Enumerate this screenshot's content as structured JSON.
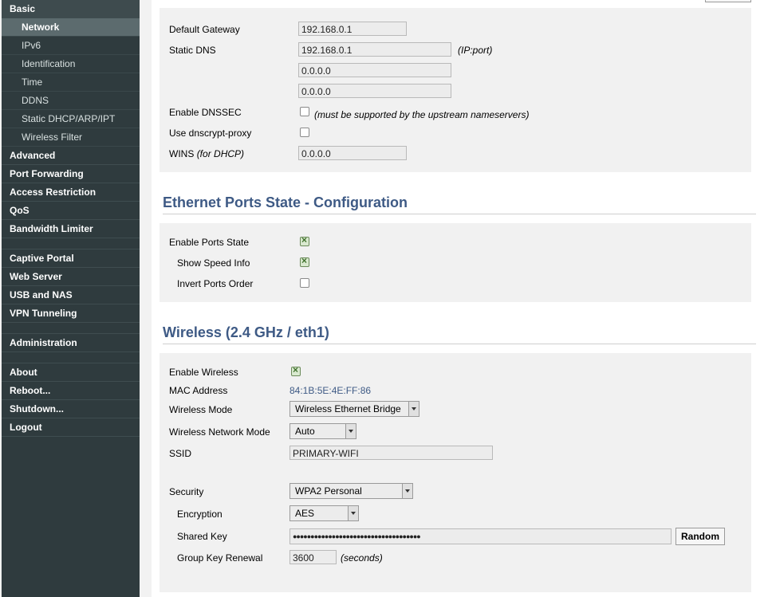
{
  "sidebar": {
    "basic": "Basic",
    "basic_items": [
      "Network",
      "IPv6",
      "Identification",
      "Time",
      "DDNS",
      "Static DHCP/ARP/IPT",
      "Wireless Filter"
    ],
    "group1": [
      "Advanced",
      "Port Forwarding",
      "Access Restriction",
      "QoS",
      "Bandwidth Limiter"
    ],
    "group2": [
      "Captive Portal",
      "Web Server",
      "USB and NAS",
      "VPN Tunneling"
    ],
    "group3": [
      "Administration"
    ],
    "group4": [
      "About",
      "Reboot...",
      "Shutdown...",
      "Logout"
    ]
  },
  "lan": {
    "default_gateway_label": "Default Gateway",
    "default_gateway": "192.168.0.1",
    "static_dns_label": "Static DNS",
    "dns1": "192.168.0.1",
    "dns2": "0.0.0.0",
    "dns3": "0.0.0.0",
    "dns_hint": "(IP:port)",
    "dnssec_label": "Enable DNSSEC",
    "dnssec_hint": "(must be supported by the upstream nameservers)",
    "dnscrypt_label": "Use dnscrypt-proxy",
    "wins_label": "WINS",
    "wins_suffix": "(for DHCP)",
    "wins": "0.0.0.0"
  },
  "ports": {
    "title": "Ethernet Ports State - Configuration",
    "enable_label": "Enable Ports State",
    "speed_label": "Show Speed Info",
    "invert_label": "Invert Ports Order",
    "enable_checked": true,
    "speed_checked": true,
    "invert_checked": false
  },
  "wireless": {
    "title": "Wireless (2.4 GHz / eth1)",
    "enable_label": "Enable Wireless",
    "enable_checked": true,
    "mac_label": "MAC Address",
    "mac": "84:1B:5E:4E:FF:86",
    "mode_label": "Wireless Mode",
    "mode": "Wireless Ethernet Bridge",
    "netmode_label": "Wireless Network Mode",
    "netmode": "Auto",
    "ssid_label": "SSID",
    "ssid": "PRIMARY-WIFI",
    "security_label": "Security",
    "security": "WPA2 Personal",
    "encryption_label": "Encryption",
    "encryption": "AES",
    "shared_key_label": "Shared Key",
    "shared_key": "●●●●●●●●●●●●●●●●●●●●●●●●●●●●●●●●●●●●",
    "random_label": "Random",
    "renewal_label": "Group Key Renewal",
    "renewal": "3600",
    "renewal_unit": "(seconds)"
  }
}
